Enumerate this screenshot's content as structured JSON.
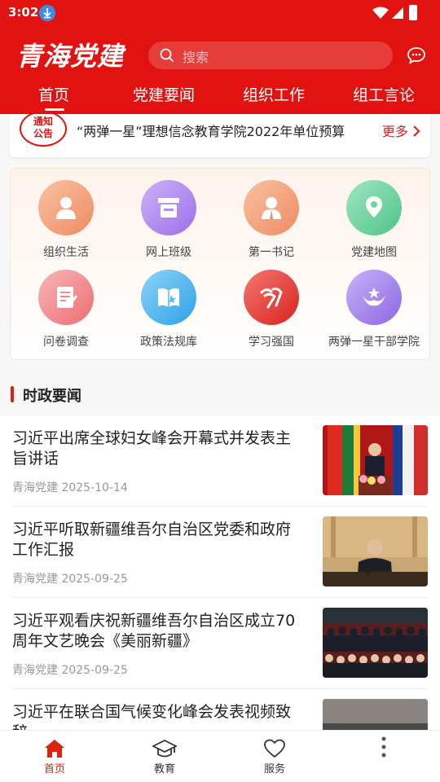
{
  "status_bar": {
    "time": "3:02"
  },
  "header": {
    "logo": "青海党建",
    "search_placeholder": "搜索",
    "tabs": [
      "首页",
      "党建要闻",
      "组织工作",
      "组工言论"
    ],
    "active_tab": "首页"
  },
  "notice": {
    "badge_line1": "通知",
    "badge_line2": "公告",
    "text": "“两弹一星”理想信念教育学院2022年单位预算",
    "more": "更多"
  },
  "grid": [
    {
      "label": "组织生活",
      "icon": "person-icon",
      "color": "#f4a37c"
    },
    {
      "label": "网上班级",
      "icon": "classroom-icon",
      "color": "#b58ef2"
    },
    {
      "label": "第一书记",
      "icon": "secretary-icon",
      "color": "#f4a37c"
    },
    {
      "label": "党建地图",
      "icon": "map-pin-icon",
      "color": "#6ed4a1"
    },
    {
      "label": "问卷调查",
      "icon": "survey-icon",
      "color": "#f08a8e"
    },
    {
      "label": "政策法规库",
      "icon": "book-icon",
      "color": "#56b9f0"
    },
    {
      "label": "学习强国",
      "icon": "xuexi-icon",
      "color": "#e8403a"
    },
    {
      "label": "两弹一星干部学院",
      "icon": "academy-emblem-icon",
      "color": "#a888ef"
    }
  ],
  "section": {
    "title": "时政要闻"
  },
  "news": [
    {
      "title": "习近平出席全球妇女峰会开幕式并发表主旨讲话",
      "source": "青海党建",
      "date": "2025-10-14"
    },
    {
      "title": "习近平听取新疆维吾尔自治区党委和政府工作汇报",
      "source": "青海党建",
      "date": "2025-09-25"
    },
    {
      "title": "习近平观看庆祝新疆维吾尔自治区成立70周年文艺晚会《美丽新疆》",
      "source": "青海党建",
      "date": "2025-09-25"
    },
    {
      "title": "习近平在联合国气候变化峰会发表视频致辞",
      "source": "",
      "date": ""
    }
  ],
  "bottom_nav": [
    {
      "label": "首页",
      "icon": "home-icon",
      "active": true
    },
    {
      "label": "教育",
      "icon": "graduation-cap-icon",
      "active": false
    },
    {
      "label": "服务",
      "icon": "heart-icon",
      "active": false
    }
  ],
  "colors": {
    "brand_red": "#e1120f",
    "accent_red": "#d22"
  }
}
